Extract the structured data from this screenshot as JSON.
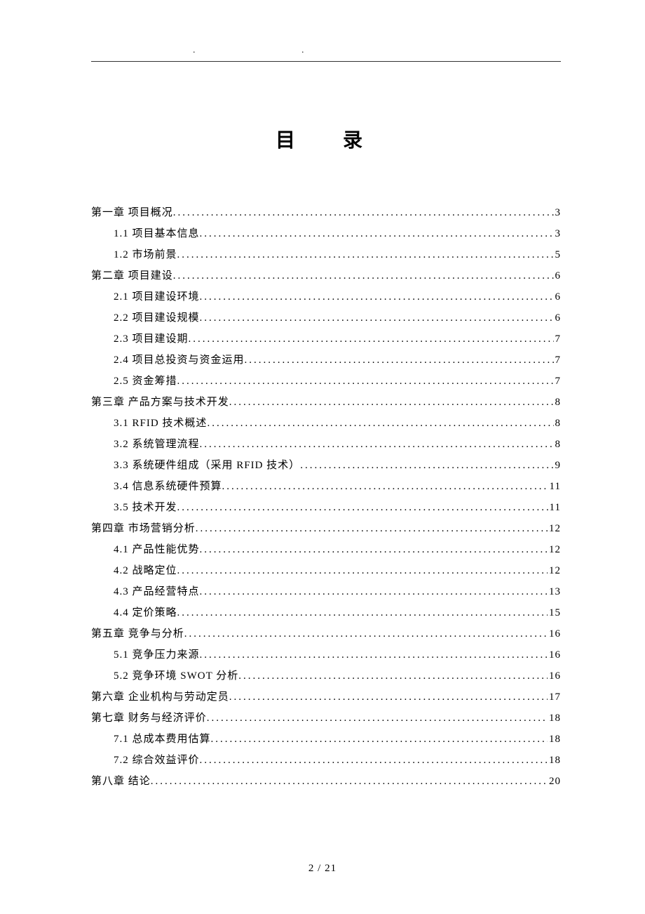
{
  "title": "目　录",
  "footer": "2 / 21",
  "toc": [
    {
      "label": "第一章 项目概况",
      "page": "3",
      "level": 0
    },
    {
      "label": "1.1 项目基本信息",
      "page": "3",
      "level": 1
    },
    {
      "label": "1.2 市场前景",
      "page": "5",
      "level": 1
    },
    {
      "label": "第二章 项目建设",
      "page": "6",
      "level": 0
    },
    {
      "label": "2.1 项目建设环境",
      "page": "6",
      "level": 1
    },
    {
      "label": "2.2 项目建设规模",
      "page": "6",
      "level": 1
    },
    {
      "label": "2.3 项目建设期",
      "page": "7",
      "level": 1
    },
    {
      "label": "2.4 项目总投资与资金运用",
      "page": "7",
      "level": 1
    },
    {
      "label": "2.5 资金筹措",
      "page": "7",
      "level": 1
    },
    {
      "label": "第三章 产品方案与技术开发",
      "page": "8",
      "level": 0
    },
    {
      "label": "3.1 RFID 技术概述",
      "page": "8",
      "level": 1
    },
    {
      "label": "3.2 系统管理流程",
      "page": "8",
      "level": 1
    },
    {
      "label": "3.3 系统硬件组成（采用 RFID 技术）",
      "page": "9",
      "level": 1
    },
    {
      "label": "3.4 信息系统硬件预算",
      "page": "11",
      "level": 1
    },
    {
      "label": "3.5 技术开发",
      "page": "11",
      "level": 1
    },
    {
      "label": "第四章 市场营销分析",
      "page": "12",
      "level": 0
    },
    {
      "label": "4.1 产品性能优势",
      "page": "12",
      "level": 1
    },
    {
      "label": "4.2 战略定位",
      "page": "12",
      "level": 1
    },
    {
      "label": "4.3 产品经营特点",
      "page": "13",
      "level": 1
    },
    {
      "label": "4.4 定价策略",
      "page": "15",
      "level": 1
    },
    {
      "label": "第五章 竞争与分析",
      "page": "16",
      "level": 0
    },
    {
      "label": "5.1 竞争压力来源",
      "page": "16",
      "level": 1
    },
    {
      "label": "5.2 竞争环境 SWOT 分析",
      "page": "16",
      "level": 1
    },
    {
      "label": "第六章 企业机构与劳动定员",
      "page": "17",
      "level": 0
    },
    {
      "label": "第七章 财务与经济评价",
      "page": "18",
      "level": 0
    },
    {
      "label": "7.1 总成本费用估算",
      "page": "18",
      "level": 1
    },
    {
      "label": "7.2 综合效益评价",
      "page": "18",
      "level": 1
    },
    {
      "label": "第八章 结论",
      "page": "20",
      "level": 0
    }
  ]
}
